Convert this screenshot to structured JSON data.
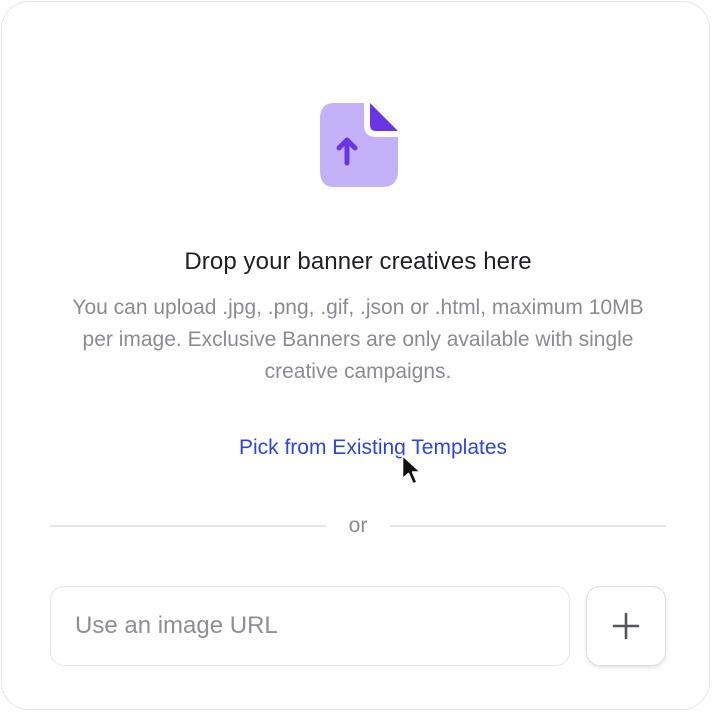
{
  "dropzone": {
    "icon": "file-upload-icon",
    "headline": "Drop your banner creatives here",
    "description": "You can upload .jpg, .png, .gif, .json or .html, maximum 10MB per image. Exclusive Banners are only available with single creative campaigns.",
    "template_link": "Pick from Existing Templates",
    "separator": "or"
  },
  "url_field": {
    "placeholder": "Use an image URL",
    "value": ""
  },
  "add_button": {
    "icon": "plus-icon"
  },
  "colors": {
    "icon_fill": "#c4b1f7",
    "icon_accent": "#6a35e3",
    "link": "#2f47d6",
    "heading": "#1f1f24",
    "muted_text": "#8b8b94",
    "border": "#e6e6ea"
  }
}
